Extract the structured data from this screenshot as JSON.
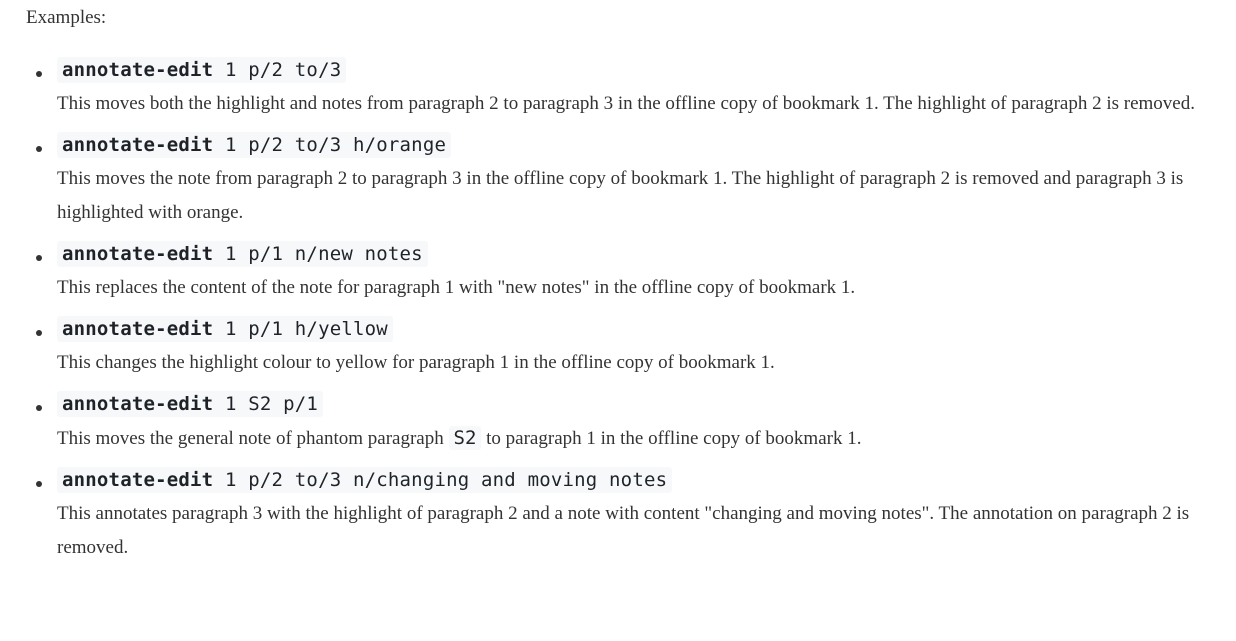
{
  "heading": "Examples:",
  "examples": [
    {
      "keyword": "annotate-edit",
      "args": " 1 p/2 to/3",
      "description": "This moves both the highlight and notes from paragraph 2 to paragraph 3 in the offline copy of bookmark 1. The highlight of paragraph 2 is removed."
    },
    {
      "keyword": "annotate-edit",
      "args": " 1 p/2 to/3 h/orange",
      "description": "This moves the note from paragraph 2 to paragraph 3 in the offline copy of bookmark 1. The highlight of paragraph 2 is removed and paragraph 3 is highlighted with orange."
    },
    {
      "keyword": "annotate-edit",
      "args": " 1 p/1 n/new notes",
      "description": "This replaces the content of the note for paragraph 1 with \"new notes\" in the offline copy of bookmark 1."
    },
    {
      "keyword": "annotate-edit",
      "args": " 1 p/1 h/yellow",
      "description": "This changes the highlight colour to yellow for paragraph 1 in the offline copy of bookmark 1."
    },
    {
      "keyword": "annotate-edit",
      "args": " 1 S2 p/1",
      "description_before": "This moves the general note of phantom paragraph ",
      "description_code": "S2",
      "description_after": " to paragraph 1 in the offline copy of bookmark 1."
    },
    {
      "keyword": "annotate-edit",
      "args": " 1 p/2 to/3 n/changing and moving notes",
      "description": "This annotates paragraph 3 with the highlight of paragraph 2 and a note with content \"changing and moving notes\". The annotation on paragraph 2 is removed."
    }
  ]
}
